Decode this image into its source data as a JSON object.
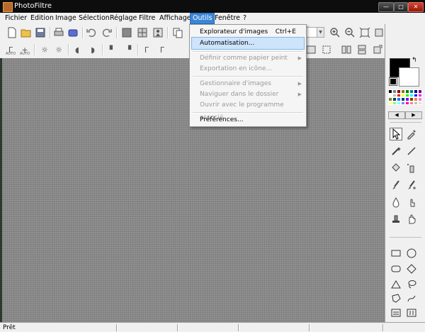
{
  "window": {
    "title": "PhotoFiltre",
    "minimize": "—",
    "maximize": "□",
    "close": "✕"
  },
  "menubar": {
    "items": [
      "Fichier",
      "Edition",
      "Image",
      "Sélection",
      "Réglage",
      "Filtre",
      "Affichage",
      "Outils",
      "Fenêtre",
      "?"
    ],
    "active": "Outils"
  },
  "dropdown": {
    "items": [
      {
        "label": "Explorateur d'images",
        "shortcut": "Ctrl+E",
        "enabled": true
      },
      {
        "label": "Automatisation...",
        "enabled": true,
        "highlighted": true
      },
      {
        "label": "Définir comme papier peint",
        "enabled": false,
        "submenu": true
      },
      {
        "label": "Exportation en icône...",
        "enabled": false
      },
      {
        "label": "Gestionnaire d'images",
        "enabled": false,
        "submenu": true
      },
      {
        "label": "Naviguer dans le dossier",
        "enabled": false,
        "submenu": true
      },
      {
        "label": "Ouvrir avec le programme associé",
        "enabled": false
      },
      {
        "label": "Préférences...",
        "enabled": true
      }
    ],
    "submenu_arrow": "▶"
  },
  "toolbar": {
    "auto_label": "AUTO"
  },
  "colors": {
    "foreground": "#000000",
    "background": "#ffffff",
    "accent": "#3b86d8",
    "workspace": "#8a8a8a"
  },
  "palette": [
    "#000000",
    "#808080",
    "#800000",
    "#808000",
    "#008000",
    "#008080",
    "#000080",
    "#800080",
    "#ffffff",
    "#c0c0c0",
    "#ff0000",
    "#ffff00",
    "#00ff00",
    "#00ffff",
    "#0000ff",
    "#ff00ff",
    "#808040",
    "#004040",
    "#0080ff",
    "#004080",
    "#8000ff",
    "#804000",
    "#ff8040",
    "#ff80c0",
    "#ffff80",
    "#80ff80",
    "#80ffff",
    "#8080ff",
    "#ff0080",
    "#ff8080",
    "#c0c0c0",
    "#e0e0e0"
  ],
  "palette_nav": {
    "left": "◀",
    "right": "▶"
  },
  "status": {
    "text": "Prêt"
  }
}
